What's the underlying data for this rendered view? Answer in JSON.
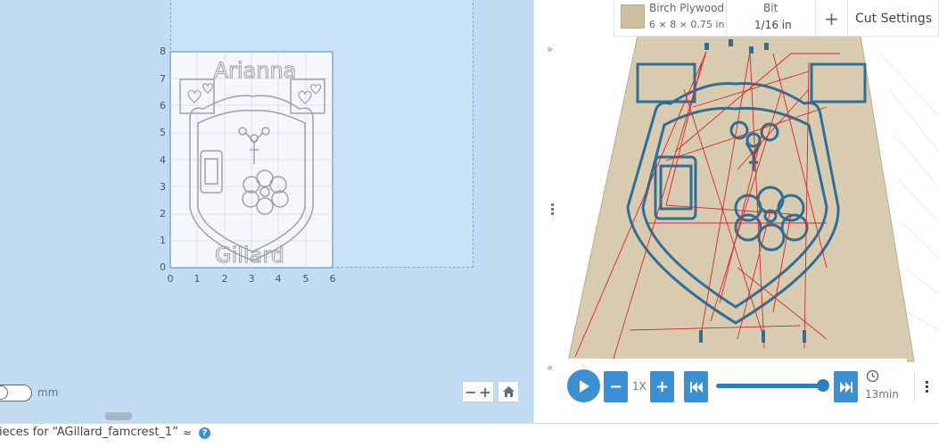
{
  "canvas": {
    "y_ticks": [
      "0",
      "1",
      "2",
      "3",
      "4",
      "5",
      "6",
      "7",
      "8"
    ],
    "x_ticks": [
      "0",
      "1",
      "2",
      "3",
      "4",
      "5",
      "6"
    ],
    "design_text_top": "Arianna",
    "design_text_bottom": "Gillard",
    "unit_label": "mm",
    "zoom_out_label": "−",
    "zoom_in_label": "+"
  },
  "material": {
    "name": "Birch Plywood",
    "dimensions": "6 × 8 × 0.75 in",
    "bit_title": "Bit",
    "bit_value": "1/16 in",
    "add_label": "+",
    "cut_settings_label": "Cut Settings",
    "swatch_color": "#cdbf9e"
  },
  "playback": {
    "speed_label": "1X",
    "time_label": "13min",
    "progress": 1.0,
    "minus_label": "−",
    "plus_label": "+"
  },
  "bottom": {
    "pieces_label": "ieces for “AGillard_famcrest_1”",
    "caret": "≈",
    "help": "?"
  },
  "splitter": {
    "collapse_top": "»",
    "collapse_bottom": "«"
  },
  "colors": {
    "accent": "#3d8fd4",
    "canvas_bg": "#c1dbf3",
    "path_blue": "#2f6f96",
    "path_red": "#d42a2a"
  }
}
